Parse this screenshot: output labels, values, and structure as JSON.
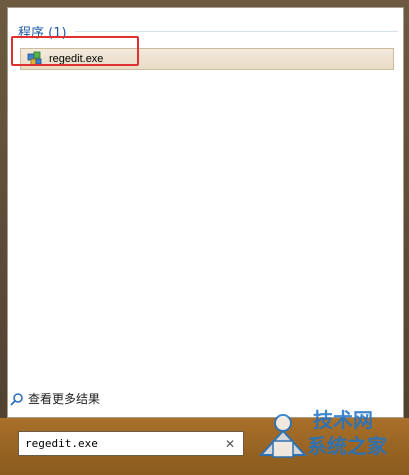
{
  "results": {
    "group_title": "程序 (1)",
    "items": [
      {
        "label": "regedit.exe",
        "icon": "regedit-icon"
      }
    ]
  },
  "more_results": {
    "label": "查看更多结果",
    "icon": "search-icon"
  },
  "search": {
    "value": "regedit.exe",
    "clear_icon": "close-icon"
  },
  "watermark": {
    "line1": "技术网",
    "line2": "系统之家",
    "brand_color": "#1e73c8"
  },
  "colors": {
    "highlight": "#e03030",
    "group_title": "#1e5aa8",
    "selected_row": "#ecdcc4"
  }
}
